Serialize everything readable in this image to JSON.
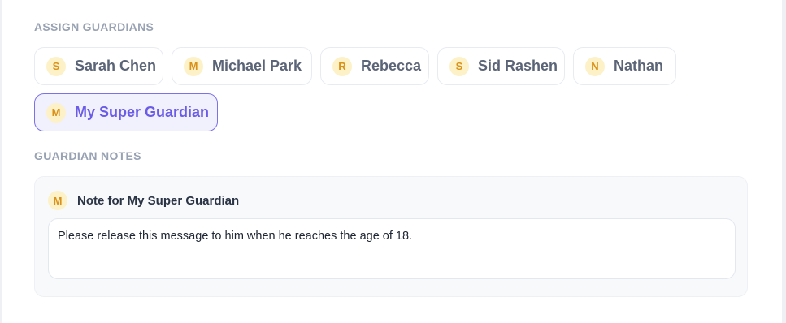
{
  "assign": {
    "heading": "ASSIGN GUARDIANS",
    "guardians": [
      {
        "initial": "S",
        "name": "Sarah Chen",
        "selected": false
      },
      {
        "initial": "M",
        "name": "Michael Park",
        "selected": false
      },
      {
        "initial": "R",
        "name": "Rebecca",
        "selected": false
      },
      {
        "initial": "S",
        "name": "Sid Rashen",
        "selected": false
      },
      {
        "initial": "N",
        "name": "Nathan",
        "selected": false
      },
      {
        "initial": "M",
        "name": "My Super Guardian",
        "selected": true
      }
    ]
  },
  "notes": {
    "heading": "GUARDIAN NOTES",
    "entry": {
      "initial": "M",
      "title": "Note for My Super Guardian",
      "text": "Please release this message to him when he reaches the age of 18."
    }
  },
  "colors": {
    "accent": "#6b5ce7",
    "avatar_bg": "#fdf1c8",
    "avatar_text": "#d9911a",
    "muted_heading": "#98a2b3"
  },
  "icons": {
    "avatar": "initial-avatar-icon"
  }
}
